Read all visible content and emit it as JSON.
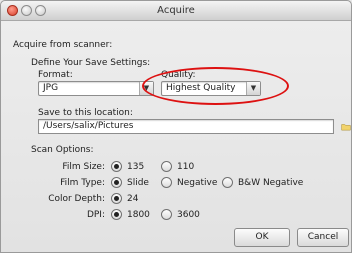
{
  "window": {
    "title": "Acquire"
  },
  "section": {
    "heading": "Acquire from scanner:"
  },
  "save_settings": {
    "heading": "Define Your Save Settings:",
    "format_label": "Format:",
    "format_value": "JPG",
    "quality_label": "Quality:",
    "quality_value": "Highest Quality",
    "location_label": "Save to this location:",
    "location_value": "/Users/salix/Pictures"
  },
  "scan_options": {
    "heading": "Scan Options:",
    "film_size_label": "Film Size:",
    "film_size_options": [
      "135",
      "110"
    ],
    "film_type_label": "Film Type:",
    "film_type_options": [
      "Slide",
      "Negative",
      "B&W Negative"
    ],
    "color_depth_label": "Color Depth:",
    "color_depth_options": [
      "24"
    ],
    "dpi_label": "DPI:",
    "dpi_options": [
      "1800",
      "3600"
    ]
  },
  "buttons": {
    "ok": "OK",
    "cancel": "Cancel"
  },
  "colors": {
    "highlight_circle": "#dd1111"
  }
}
